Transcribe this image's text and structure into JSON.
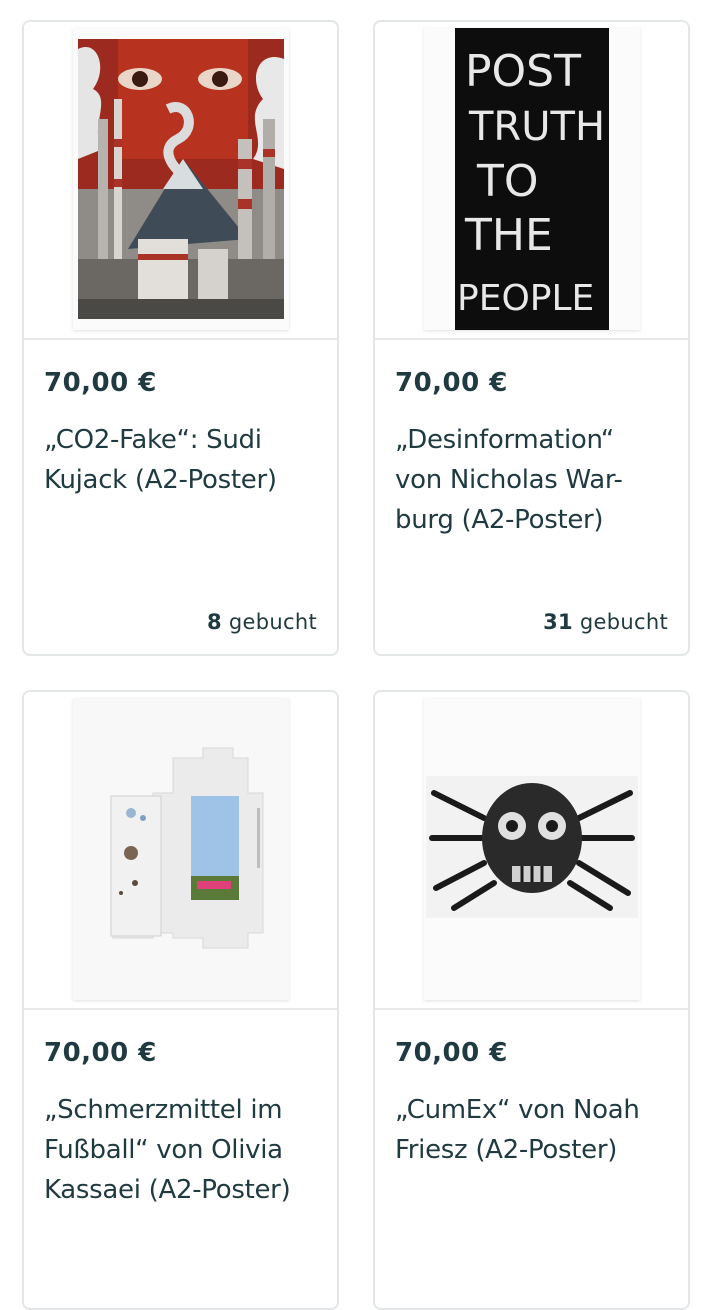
{
  "products": [
    {
      "price": "70,00 €",
      "title": "„CO2-Fake“: Sudi Kujack (A2-Poster)",
      "booked_count": "8",
      "booked_label": "gebucht",
      "image_icon": "poster-co2-fake-image"
    },
    {
      "price": "70,00 €",
      "title": "„Desinformation“ von Nicholas War-burg (A2-Poster)",
      "poster_text": [
        "POST",
        "TRUTH",
        "TO",
        "THE",
        "PEOPLE"
      ],
      "booked_count": "31",
      "booked_label": "gebucht",
      "image_icon": "poster-post-truth-image"
    },
    {
      "price": "70,00 €",
      "title": "„Schmerzmittel im Fußball“ von Olivia Kassaei (A2-Poster)",
      "image_icon": "poster-schmerzmittel-image"
    },
    {
      "price": "70,00 €",
      "title": "„CumEx“ von Noah Friesz (A2-Poster)",
      "image_icon": "poster-cumex-image"
    }
  ],
  "colors": {
    "text": "#1f3a40",
    "border": "#e3e6e7",
    "background": "#ffffff"
  }
}
